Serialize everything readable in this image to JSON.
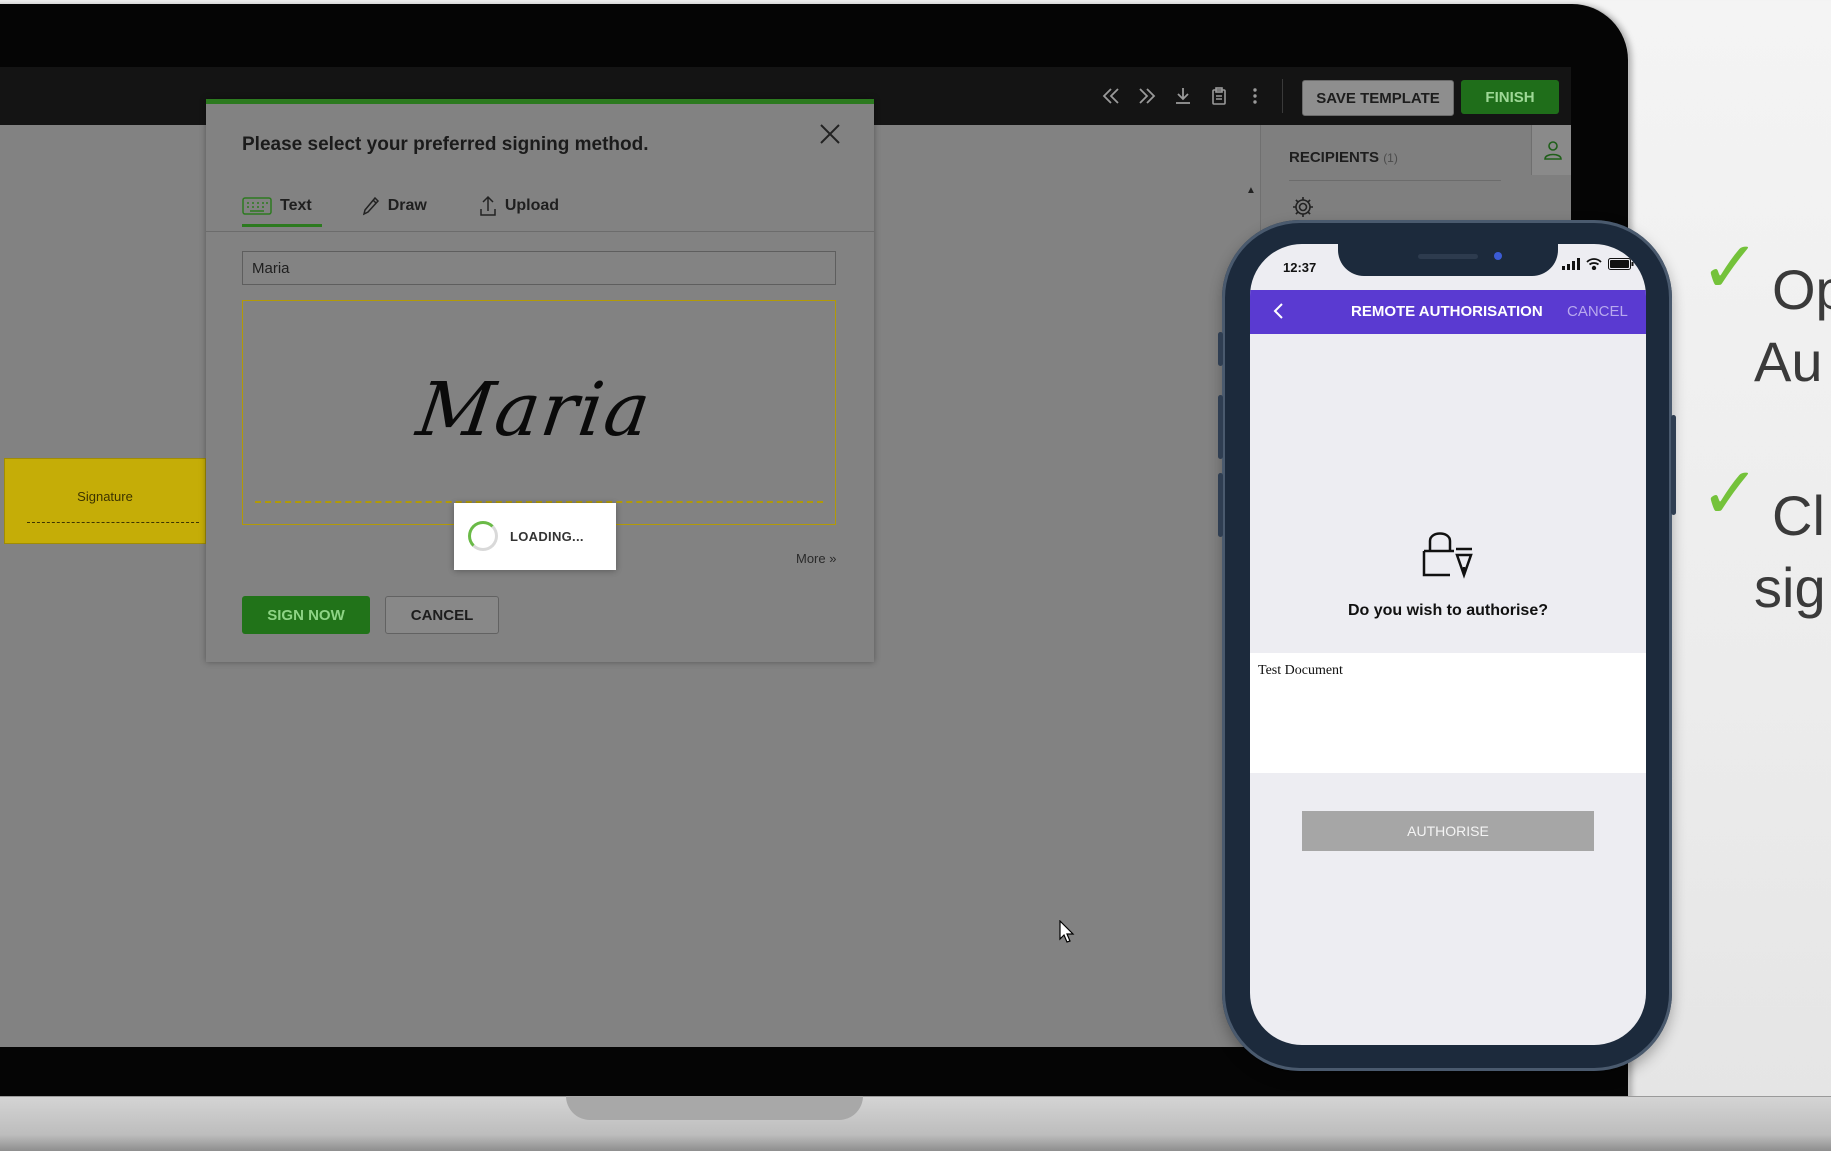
{
  "toolbar": {
    "save_template_label": "SAVE TEMPLATE",
    "finish_label": "FINISH",
    "icons": [
      "double-chevron-left-icon",
      "double-chevron-right-icon",
      "download-icon",
      "clipboard-icon",
      "more-vert-icon"
    ]
  },
  "recipients": {
    "title": "RECIPIENTS",
    "count": "(1)"
  },
  "document": {
    "signature_field_label": "Signature"
  },
  "modal": {
    "title": "Please select your preferred signing method.",
    "tabs": [
      {
        "label": "Text",
        "icon": "keyboard-icon",
        "active": true
      },
      {
        "label": "Draw",
        "icon": "pen-icon",
        "active": false
      },
      {
        "label": "Upload",
        "icon": "upload-icon",
        "active": false
      }
    ],
    "name_value": "Maria",
    "signature_preview": "Maria",
    "more_label": "More »",
    "sign_now_label": "SIGN NOW",
    "cancel_label": "CANCEL",
    "loading_label": "LOADING..."
  },
  "phone": {
    "time": "12:37",
    "title": "REMOTE AUTHORISATION",
    "cancel_label": "CANCEL",
    "question": "Do you wish to authorise?",
    "document_name": "Test Document",
    "authorise_label": "AUTHORISE",
    "accent_color": "#5a3ad1"
  },
  "features": [
    {
      "line1": "Op",
      "line2": "Au"
    },
    {
      "line1": "Cl",
      "line2": "sig"
    }
  ],
  "colors": {
    "brand_green": "#2c7a1f",
    "check_green": "#74c23a",
    "signature_field": "#c5ad07"
  }
}
